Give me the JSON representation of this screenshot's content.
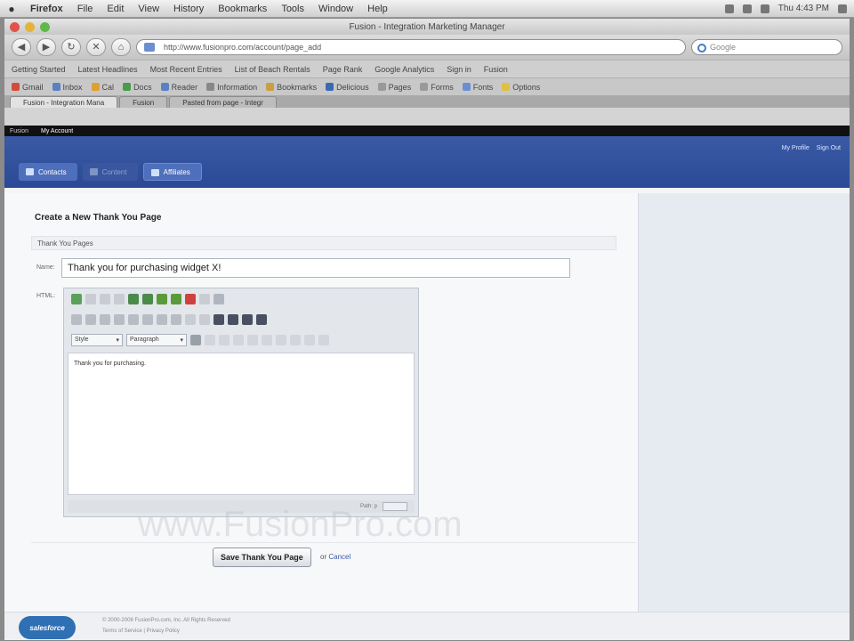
{
  "menubar": {
    "app": "Firefox",
    "items": [
      "File",
      "Edit",
      "View",
      "History",
      "Bookmarks",
      "Tools",
      "Window",
      "Help"
    ],
    "clock": "Thu 4:43 PM"
  },
  "window": {
    "title": "Fusion - Integration Marketing Manager"
  },
  "navbar": {
    "url": "http://www.fusionpro.com/account/page_add",
    "search_placeholder": "Google"
  },
  "bookmarks": [
    "Getting Started",
    "Latest Headlines",
    "Most Recent Entries",
    "List of Beach Rentals",
    "Page Rank",
    "Google Analytics",
    "Sign in",
    "Fusion"
  ],
  "toolbar2": [
    "Gmail",
    "Inbox",
    "Cal",
    "Docs",
    "Reader",
    "Information",
    "Bookmarks",
    "Delicious",
    "Pages",
    "Forms",
    "Fonts",
    "Options"
  ],
  "tabs": [
    {
      "label": "Fusion - Integration Mana"
    },
    {
      "label": "Fusion"
    },
    {
      "label": "Pasted from page - Integr"
    }
  ],
  "app": {
    "strip": [
      "Fusion",
      "My Account"
    ],
    "account": [
      "My Profile",
      "Sign Out"
    ],
    "tabs": [
      {
        "label": "Contacts"
      },
      {
        "label": "Content"
      },
      {
        "label": "Affiliates"
      }
    ]
  },
  "form": {
    "heading": "Create a New Thank You Page",
    "section": "Thank You Pages",
    "name_label": "Name:",
    "name_value": "Thank you for purchasing widget X!",
    "html_label": "HTML:",
    "format_select": "Style",
    "paragraph_select": "Paragraph",
    "editor_text": "Thank you for purchasing.",
    "editor_path": "Path: p",
    "save_button": "Save Thank You Page",
    "or_text": "or",
    "cancel_link": "Cancel",
    "watermark": "www.FusionPro.com"
  },
  "footer": {
    "logo": "salesforce",
    "line1": "© 2000-2008 FusionPro.com, Inc. All Rights Reserved",
    "line2": "Terms of Service | Privacy Policy"
  }
}
